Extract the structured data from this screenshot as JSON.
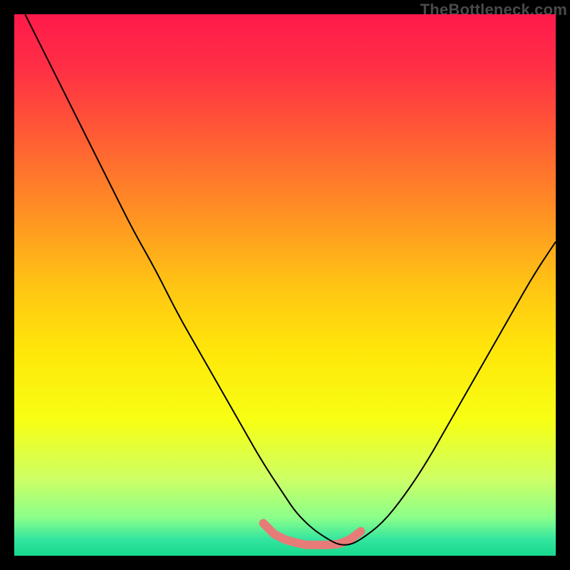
{
  "watermark": "TheBottleneck.com",
  "chart_data": {
    "type": "line",
    "title": "",
    "xlabel": "",
    "ylabel": "",
    "xlim": [
      0,
      100
    ],
    "ylim": [
      0,
      100
    ],
    "background_gradient": {
      "stops": [
        {
          "pos": 0.0,
          "color": "#ff1a4b"
        },
        {
          "pos": 0.1,
          "color": "#ff2f45"
        },
        {
          "pos": 0.22,
          "color": "#ff5a35"
        },
        {
          "pos": 0.35,
          "color": "#ff8a25"
        },
        {
          "pos": 0.5,
          "color": "#ffc414"
        },
        {
          "pos": 0.62,
          "color": "#ffe60a"
        },
        {
          "pos": 0.75,
          "color": "#f7ff14"
        },
        {
          "pos": 0.86,
          "color": "#ccff66"
        },
        {
          "pos": 0.93,
          "color": "#8aff8a"
        },
        {
          "pos": 0.97,
          "color": "#33e59f"
        },
        {
          "pos": 1.0,
          "color": "#17d98e"
        }
      ]
    },
    "series": [
      {
        "name": "bottleneck-curve",
        "color": "#000000",
        "width": 2,
        "x": [
          2,
          6,
          10,
          14,
          18,
          22,
          26,
          30,
          34,
          38,
          42,
          46,
          50,
          52,
          55,
          58,
          60,
          62,
          64,
          68,
          72,
          76,
          80,
          84,
          88,
          92,
          96,
          100
        ],
        "y": [
          100,
          92,
          84,
          76,
          68,
          60,
          53,
          45,
          38,
          31,
          24,
          17,
          11,
          8,
          5,
          3,
          2,
          2,
          3,
          6,
          11,
          17,
          24,
          31,
          38,
          45,
          52,
          58
        ]
      }
    ],
    "highlight": {
      "name": "valley-highlight",
      "color": "#e77b78",
      "width": 12,
      "linecap": "round",
      "x": [
        46,
        48,
        50,
        52,
        54,
        56,
        58,
        60,
        62,
        64
      ],
      "y": [
        6,
        4,
        3,
        2.4,
        2,
        2,
        2,
        2.2,
        3,
        4.5
      ]
    }
  }
}
